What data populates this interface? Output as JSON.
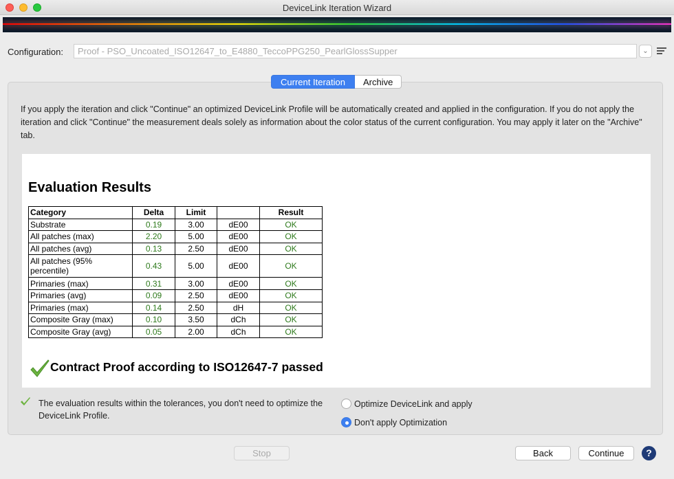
{
  "window": {
    "title": "DeviceLink Iteration Wizard"
  },
  "config": {
    "label": "Configuration:",
    "value": "Proof - PSO_Uncoated_ISO12647_to_E4880_TeccoPPG250_PearlGlossSupper"
  },
  "tabs": [
    {
      "label": "Current Iteration",
      "active": true
    },
    {
      "label": "Archive",
      "active": false
    }
  ],
  "info_text": "If you apply the iteration and click \"Continue\" an optimized DeviceLink Profile will be automatically created and applied in the configuration. If you do not apply the iteration and click \"Continue\" the measurement deals solely as information about the color status of the current configuration. You may apply it later on the \"Archive\" tab.",
  "evaluation": {
    "title": "Evaluation Results",
    "headers": [
      "Category",
      "Delta",
      "Limit",
      "",
      "Result"
    ],
    "rows": [
      {
        "category": "Substrate",
        "delta": "0.19",
        "limit": "3.00",
        "unit": "dE00",
        "result": "OK"
      },
      {
        "category": "All patches (max)",
        "delta": "2.20",
        "limit": "5.00",
        "unit": "dE00",
        "result": "OK"
      },
      {
        "category": "All patches (avg)",
        "delta": "0.13",
        "limit": "2.50",
        "unit": "dE00",
        "result": "OK"
      },
      {
        "category": "All patches (95% percentile)",
        "delta": "0.43",
        "limit": "5.00",
        "unit": "dE00",
        "result": "OK"
      },
      {
        "category": "Primaries (max)",
        "delta": "0.31",
        "limit": "3.00",
        "unit": "dE00",
        "result": "OK"
      },
      {
        "category": "Primaries (avg)",
        "delta": "0.09",
        "limit": "2.50",
        "unit": "dE00",
        "result": "OK"
      },
      {
        "category": "Primaries (max)",
        "delta": "0.14",
        "limit": "2.50",
        "unit": "dH",
        "result": "OK"
      },
      {
        "category": "Composite Gray (max)",
        "delta": "0.10",
        "limit": "3.50",
        "unit": "dCh",
        "result": "OK"
      },
      {
        "category": "Composite Gray (avg)",
        "delta": "0.05",
        "limit": "2.00",
        "unit": "dCh",
        "result": "OK"
      }
    ],
    "pass_message": "Contract Proof according to ISO12647-7 passed"
  },
  "optimization": {
    "message": "The evaluation results within the tolerances, you don't need to optimize the DeviceLink Profile.",
    "options": [
      {
        "label": "Optimize DeviceLink and apply",
        "selected": false
      },
      {
        "label": "Don't apply Optimization",
        "selected": true
      }
    ]
  },
  "buttons": {
    "stop": "Stop",
    "back": "Back",
    "continue": "Continue",
    "help": "?"
  },
  "colors": {
    "accent": "#3d7ff0",
    "ok_green": "#2e7a1c",
    "help_blue": "#1f3b77"
  }
}
